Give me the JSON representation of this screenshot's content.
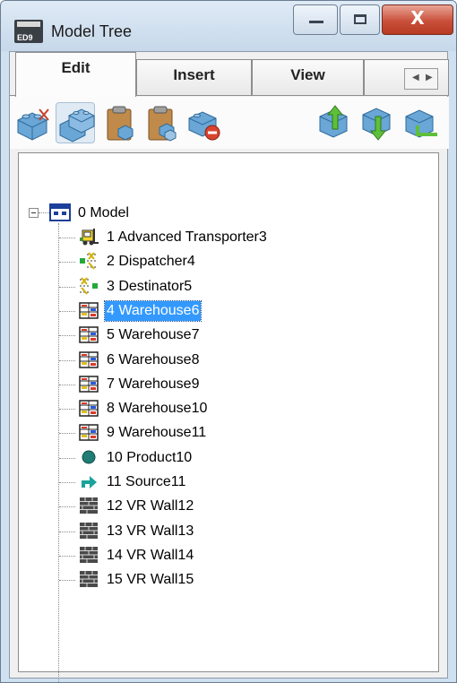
{
  "window": {
    "icon_text": "ED9",
    "title": "Model Tree",
    "close_glyph": "X"
  },
  "tabs": [
    {
      "label": "Edit",
      "active": true
    },
    {
      "label": "Insert",
      "active": false
    },
    {
      "label": "View",
      "active": false
    }
  ],
  "toolbar": {
    "buttons": [
      {
        "name": "cut-atom-button",
        "icon": "atom-cut-icon"
      },
      {
        "name": "copy-atom-button",
        "icon": "atom-copy-icon"
      },
      {
        "name": "paste-button",
        "icon": "paste-icon"
      },
      {
        "name": "paste-special-button",
        "icon": "paste-special-icon"
      },
      {
        "name": "delete-atom-button",
        "icon": "atom-delete-icon"
      },
      {
        "name": "move-up-button",
        "icon": "move-up-icon"
      },
      {
        "name": "move-down-button",
        "icon": "move-down-icon"
      },
      {
        "name": "move-into-button",
        "icon": "move-into-icon"
      }
    ]
  },
  "tree": {
    "root": {
      "label": "0 Model",
      "icon": "model-icon",
      "expanded": true
    },
    "items": [
      {
        "label": "1 Advanced Transporter3",
        "icon": "forklift-icon",
        "selected": false
      },
      {
        "label": "2 Dispatcher4",
        "icon": "dispatcher-icon",
        "selected": false
      },
      {
        "label": "3 Destinator5",
        "icon": "destinator-icon",
        "selected": false
      },
      {
        "label": "4 Warehouse6",
        "icon": "warehouse-icon",
        "selected": true
      },
      {
        "label": "5 Warehouse7",
        "icon": "warehouse-icon",
        "selected": false
      },
      {
        "label": "6 Warehouse8",
        "icon": "warehouse-icon",
        "selected": false
      },
      {
        "label": "7 Warehouse9",
        "icon": "warehouse-icon",
        "selected": false
      },
      {
        "label": "8 Warehouse10",
        "icon": "warehouse-icon",
        "selected": false
      },
      {
        "label": "9 Warehouse11",
        "icon": "warehouse-icon",
        "selected": false
      },
      {
        "label": "10 Product10",
        "icon": "product-icon",
        "selected": false
      },
      {
        "label": "11 Source11",
        "icon": "source-arrow-icon",
        "selected": false
      },
      {
        "label": "12 VR Wall12",
        "icon": "wall-icon",
        "selected": false
      },
      {
        "label": "13 VR Wall13",
        "icon": "wall-icon",
        "selected": false
      },
      {
        "label": "14 VR Wall14",
        "icon": "wall-icon",
        "selected": false
      },
      {
        "label": "15 VR Wall15",
        "icon": "wall-icon",
        "selected": false
      }
    ]
  },
  "colors": {
    "selection": "#3399ff",
    "atom_blue": "#4f93c8",
    "clipboard_brown": "#b8864a",
    "product_teal": "#1f7d76",
    "source_green": "#1aa39a"
  }
}
